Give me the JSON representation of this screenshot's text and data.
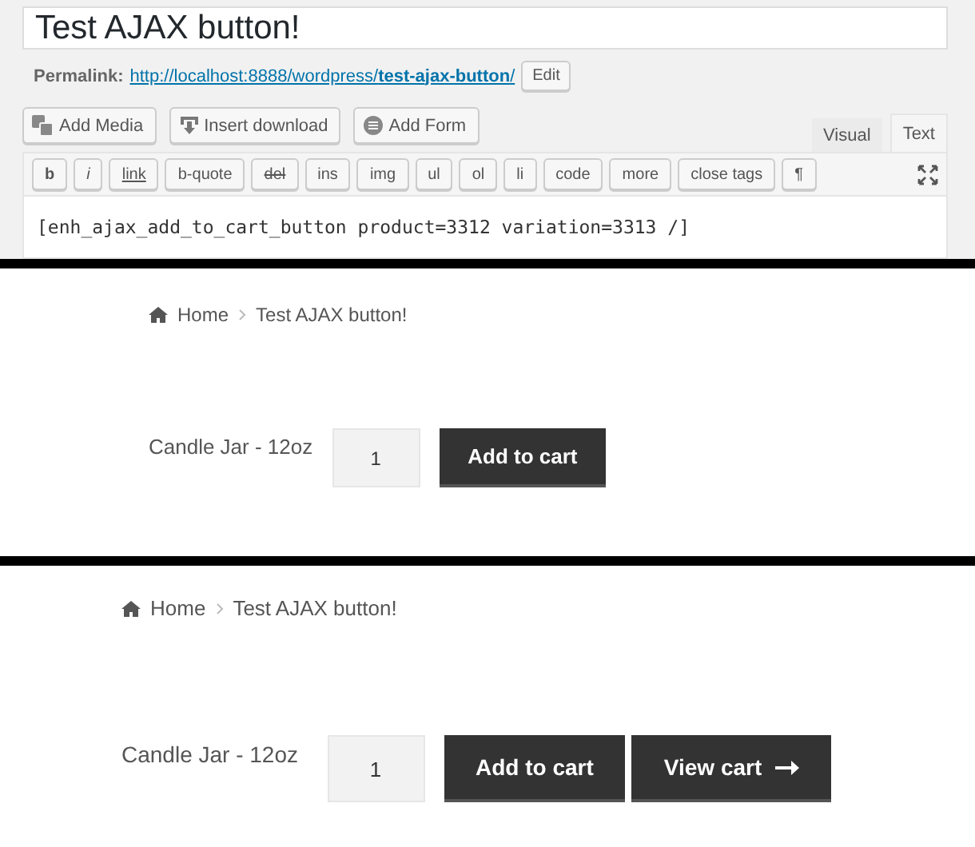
{
  "editor": {
    "title": "Test AJAX button!",
    "permalink_label": "Permalink:",
    "permalink_url": "http://localhost:8888/wordpress/**test-ajax-button**/",
    "edit_button": "Edit",
    "media_buttons": [
      {
        "label": "Add Media",
        "kind": "media"
      },
      {
        "label": "Insert download",
        "kind": "download"
      },
      {
        "label": "Add Form",
        "kind": "form"
      }
    ],
    "tabs": [
      {
        "label": "Visual",
        "selected": false
      },
      {
        "label": "Text",
        "selected": true
      }
    ],
    "quicktags": [
      {
        "label": "b",
        "kind": "bold"
      },
      {
        "label": "i",
        "kind": "italic"
      },
      {
        "label": "link",
        "kind": "link"
      },
      {
        "label": "b-quote",
        "kind": "plain"
      },
      {
        "label": "del",
        "kind": "strike"
      },
      {
        "label": "ins",
        "kind": "plain"
      },
      {
        "label": "img",
        "kind": "plain"
      },
      {
        "label": "ul",
        "kind": "plain"
      },
      {
        "label": "ol",
        "kind": "plain"
      },
      {
        "label": "li",
        "kind": "plain"
      },
      {
        "label": "code",
        "kind": "plain"
      },
      {
        "label": "more",
        "kind": "plain"
      },
      {
        "label": "close tags",
        "kind": "plain"
      },
      {
        "label": "¶",
        "kind": "plain"
      }
    ],
    "content": "[enh_ajax_add_to_cart_button product=3312 variation=3313 /]"
  },
  "previews": [
    {
      "breadcrumb": {
        "home": "Home",
        "current": "Test AJAX button!"
      },
      "product": "Candle Jar - 12oz",
      "quantity": "1",
      "buttons": [
        {
          "label": "Add to cart",
          "kind": "add"
        }
      ]
    },
    {
      "breadcrumb": {
        "home": "Home",
        "current": "Test AJAX button!"
      },
      "product": "Candle Jar - 12oz",
      "quantity": "1",
      "buttons": [
        {
          "label": "Add to cart",
          "kind": "add"
        },
        {
          "label": "View cart",
          "kind": "view"
        }
      ]
    }
  ]
}
